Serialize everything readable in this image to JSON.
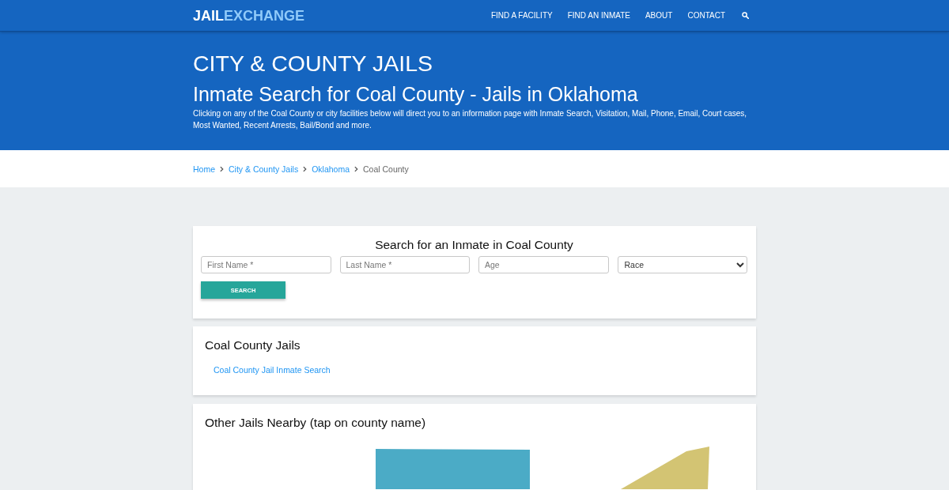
{
  "navbar": {
    "logo": {
      "part_1": "JAIL",
      "part_2": "EXCHANGE"
    },
    "links": [
      "FIND A FACILITY",
      "FIND AN INMATE",
      "ABOUT",
      "CONTACT"
    ]
  },
  "hero": {
    "title": "CITY & COUNTY JAILS",
    "subtitle": "Inmate Search for Coal County - Jails in Oklahoma",
    "description": "Clicking on any of the Coal County or city facilities below will direct you to an information page with Inmate Search, Visitation, Mail, Phone, Email, Court cases, Most Wanted, Recent Arrests, Bail/Bond and more."
  },
  "breadcrumb": [
    {
      "label": "Home",
      "kind": "link"
    },
    {
      "label": "City & County Jails",
      "kind": "link"
    },
    {
      "label": "Oklahoma",
      "kind": "link"
    },
    {
      "label": "Coal County",
      "kind": "current"
    }
  ],
  "search_card": {
    "title": "Search for an Inmate in Coal County",
    "fields": [
      {
        "kind": "input",
        "placeholder": "First Name *"
      },
      {
        "kind": "input",
        "placeholder": "Last Name *"
      },
      {
        "kind": "input",
        "placeholder": "Age"
      },
      {
        "kind": "select",
        "value": "Race"
      }
    ],
    "button": "SEARCH"
  },
  "jails_card": {
    "title": "Coal County Jails",
    "links": [
      "Coal County Jail Inmate Search"
    ]
  },
  "nearby_card": {
    "title": "Other Jails Nearby (tap on county name)"
  }
}
